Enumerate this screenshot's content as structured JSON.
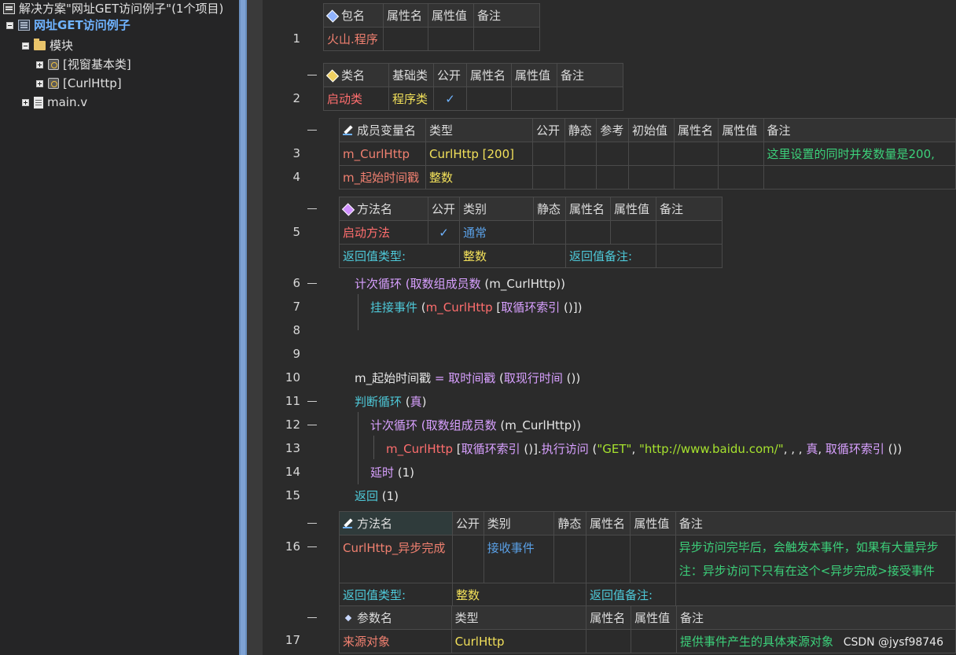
{
  "sidebar": {
    "solution": "解决方案\"网址GET访问例子\"(1个项目)",
    "project": "网址GET访问例子",
    "module_folder": "模块",
    "class1": "[视窗基本类]",
    "class2": "[CurlHttp]",
    "file": "main.v"
  },
  "package_table": {
    "headers": [
      "包名",
      "属性名",
      "属性值",
      "备注"
    ],
    "name": "火山.程序"
  },
  "class_table": {
    "headers": [
      "类名",
      "基础类",
      "公开",
      "属性名",
      "属性值",
      "备注"
    ],
    "name": "启动类",
    "base": "程序类",
    "public": "✓"
  },
  "member_table": {
    "headers": [
      "成员变量名",
      "类型",
      "公开",
      "静态",
      "参考",
      "初始值",
      "属性名",
      "属性值",
      "备注"
    ],
    "rows": [
      {
        "name": "m_CurlHttp",
        "type": "CurlHttp [200]",
        "note": "这里设置的同时并发数量是200,"
      },
      {
        "name": "m_起始时间戳",
        "type": "整数",
        "note": ""
      }
    ]
  },
  "method1_table": {
    "headers": [
      "方法名",
      "公开",
      "类别",
      "静态",
      "属性名",
      "属性值",
      "备注"
    ],
    "name": "启动方法",
    "public": "✓",
    "category": "通常",
    "ret_type_label": "返回值类型:",
    "ret_type": "整数",
    "ret_note_label": "返回值备注:"
  },
  "code": {
    "l6a": "计次循环 (",
    "l6b": "取数组成员数",
    "l6c": " (m_CurlHttp))",
    "l7a": "挂接事件",
    "l7b": " (",
    "l7c": "m_CurlHttp",
    "l7d": " [",
    "l7e": "取循环索引",
    "l7f": " ()])",
    "l10a": "m_起始时间戳",
    "l10b": " = ",
    "l10c": "取时间戳",
    "l10d": " (",
    "l10e": "取现行时间",
    "l10f": " ())",
    "l11a": "判断循环",
    "l11b": " (",
    "l11c": "真",
    "l11d": ")",
    "l12a": "计次循环 (",
    "l12b": "取数组成员数",
    "l12c": " (m_CurlHttp))",
    "l13a": "m_CurlHttp",
    "l13b": " [",
    "l13c": "取循环索引",
    "l13d": " ()].",
    "l13e": "执行访问",
    "l13f": " (",
    "l13g": "\"GET\"",
    "l13h": ", ",
    "l13i": "\"http://www.baidu.com/\"",
    "l13j": ", , , ",
    "l13k": "真",
    "l13l": ", ",
    "l13m": "取循环索引",
    "l13n": " ())",
    "l14a": "延时",
    "l14b": " (1)",
    "l15a": "返回",
    "l15b": " (1)"
  },
  "method2_table": {
    "headers": [
      "方法名",
      "公开",
      "类别",
      "静态",
      "属性名",
      "属性值",
      "备注"
    ],
    "name": "CurlHttp_异步完成",
    "category": "接收事件",
    "note1": "异步访问完毕后，会触发本事件，如果有大量异步",
    "note2": "注：异步访问下只有在这个<异步完成>接受事件",
    "ret_type_label": "返回值类型:",
    "ret_type": "整数",
    "ret_note_label": "返回值备注:"
  },
  "param_table": {
    "headers": [
      "参数名",
      "类型",
      "属性名",
      "属性值",
      "备注"
    ],
    "name": "来源对象",
    "type": "CurlHttp",
    "note": "提供事件产生的具体来源对象"
  },
  "line_numbers": [
    "1",
    "2",
    "3",
    "4",
    "5",
    "6",
    "7",
    "8",
    "9",
    "10",
    "11",
    "12",
    "13",
    "14",
    "15",
    "16",
    "17"
  ],
  "watermark": "CSDN @jysf98746"
}
